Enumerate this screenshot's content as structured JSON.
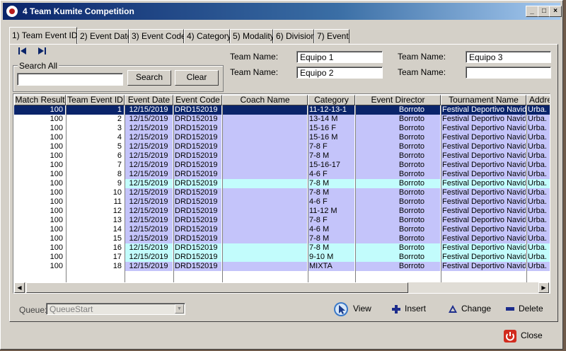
{
  "window": {
    "title": "4 Team Kumite Competition",
    "controls": [
      "_",
      "□",
      "×"
    ]
  },
  "tabs": [
    {
      "label": "1) Team Event ID",
      "active": true
    },
    {
      "label": "2) Event Date"
    },
    {
      "label": "3) Event Code"
    },
    {
      "label": "4) Category"
    },
    {
      "label": "5) Modality"
    },
    {
      "label": "6) Division"
    },
    {
      "label": "7) Event"
    }
  ],
  "nav": {
    "first_icon": "first-record-icon",
    "last_icon": "last-record-icon"
  },
  "search": {
    "group_label": "Search All",
    "value": "",
    "search_button": "Search",
    "clear_button": "Clear"
  },
  "team_names": {
    "label": "Team Name:",
    "team1": "Equipo 1",
    "team2": "Equipo 2",
    "team3": "Equipo 3",
    "team4": ""
  },
  "grid": {
    "columns": [
      "Match Result",
      "Team Event ID",
      "Event Date",
      "Event Code",
      "Coach Name",
      "Category",
      "Event Director",
      "Tournament Name",
      "Addre"
    ],
    "rows": [
      {
        "match_result": "100",
        "team_event_id": "1",
        "event_date": "12/15/2019",
        "event_code": "DRD152019",
        "coach_name": "",
        "category": "11-12-13-1",
        "event_director": "Borroto",
        "tournament_name": "Festival Deportivo Navid",
        "address": "Urba. I",
        "state": "selected"
      },
      {
        "match_result": "100",
        "team_event_id": "2",
        "event_date": "12/15/2019",
        "event_code": "DRD152019",
        "coach_name": "",
        "category": "13-14 M",
        "event_director": "Borroto",
        "tournament_name": "Festival Deportivo Navid",
        "address": "Urba. I",
        "state": "purple"
      },
      {
        "match_result": "100",
        "team_event_id": "3",
        "event_date": "12/15/2019",
        "event_code": "DRD152019",
        "coach_name": "",
        "category": "15-16 F",
        "event_director": "Borroto",
        "tournament_name": "Festival Deportivo Navid",
        "address": "Urba. I",
        "state": "purple"
      },
      {
        "match_result": "100",
        "team_event_id": "4",
        "event_date": "12/15/2019",
        "event_code": "DRD152019",
        "coach_name": "",
        "category": "15-16 M",
        "event_director": "Borroto",
        "tournament_name": "Festival Deportivo Navid",
        "address": "Urba. I",
        "state": "purple"
      },
      {
        "match_result": "100",
        "team_event_id": "5",
        "event_date": "12/15/2019",
        "event_code": "DRD152019",
        "coach_name": "",
        "category": "7-8 F",
        "event_director": "Borroto",
        "tournament_name": "Festival Deportivo Navid",
        "address": "Urba. I",
        "state": "purple"
      },
      {
        "match_result": "100",
        "team_event_id": "6",
        "event_date": "12/15/2019",
        "event_code": "DRD152019",
        "coach_name": "",
        "category": "7-8 M",
        "event_director": "Borroto",
        "tournament_name": "Festival Deportivo Navid",
        "address": "Urba. I",
        "state": "purple"
      },
      {
        "match_result": "100",
        "team_event_id": "7",
        "event_date": "12/15/2019",
        "event_code": "DRD152019",
        "coach_name": "",
        "category": "15-16-17",
        "event_director": "Borroto",
        "tournament_name": "Festival Deportivo Navid",
        "address": "Urba. I",
        "state": "purple"
      },
      {
        "match_result": "100",
        "team_event_id": "8",
        "event_date": "12/15/2019",
        "event_code": "DRD152019",
        "coach_name": "",
        "category": "4-6 F",
        "event_director": "Borroto",
        "tournament_name": "Festival Deportivo Navid",
        "address": "Urba. I",
        "state": "purple"
      },
      {
        "match_result": "100",
        "team_event_id": "9",
        "event_date": "12/15/2019",
        "event_code": "DRD152019",
        "coach_name": "",
        "category": "7-8 M",
        "event_director": "Borroto",
        "tournament_name": "Festival Deportivo Navid",
        "address": "Urba. I",
        "state": "cyan"
      },
      {
        "match_result": "100",
        "team_event_id": "10",
        "event_date": "12/15/2019",
        "event_code": "DRD152019",
        "coach_name": "",
        "category": "7-8 M",
        "event_director": "Borroto",
        "tournament_name": "Festival Deportivo Navid",
        "address": "Urba. I",
        "state": "purple"
      },
      {
        "match_result": "100",
        "team_event_id": "11",
        "event_date": "12/15/2019",
        "event_code": "DRD152019",
        "coach_name": "",
        "category": "4-6 F",
        "event_director": "Borroto",
        "tournament_name": "Festival Deportivo Navid",
        "address": "Urba. I",
        "state": "purple"
      },
      {
        "match_result": "100",
        "team_event_id": "12",
        "event_date": "12/15/2019",
        "event_code": "DRD152019",
        "coach_name": "",
        "category": "11-12 M",
        "event_director": "Borroto",
        "tournament_name": "Festival Deportivo Navid",
        "address": "Urba. I",
        "state": "purple"
      },
      {
        "match_result": "100",
        "team_event_id": "13",
        "event_date": "12/15/2019",
        "event_code": "DRD152019",
        "coach_name": "",
        "category": "7-8 F",
        "event_director": "Borroto",
        "tournament_name": "Festival Deportivo Navid",
        "address": "Urba. I",
        "state": "purple"
      },
      {
        "match_result": "100",
        "team_event_id": "14",
        "event_date": "12/15/2019",
        "event_code": "DRD152019",
        "coach_name": "",
        "category": "4-6 M",
        "event_director": "Borroto",
        "tournament_name": "Festival Deportivo Navid",
        "address": "Urba. I",
        "state": "purple"
      },
      {
        "match_result": "100",
        "team_event_id": "15",
        "event_date": "12/15/2019",
        "event_code": "DRD152019",
        "coach_name": "",
        "category": "7-8 M",
        "event_director": "Borroto",
        "tournament_name": "Festival Deportivo Navid",
        "address": "Urba. I",
        "state": "purple"
      },
      {
        "match_result": "100",
        "team_event_id": "16",
        "event_date": "12/15/2019",
        "event_code": "DRD152019",
        "coach_name": "",
        "category": "7-8 M",
        "event_director": "Borroto",
        "tournament_name": "Festival Deportivo Navid",
        "address": "Urba. I",
        "state": "cyan"
      },
      {
        "match_result": "100",
        "team_event_id": "17",
        "event_date": "12/15/2019",
        "event_code": "DRD152019",
        "coach_name": "",
        "category": "9-10 M",
        "event_director": "Borroto",
        "tournament_name": "Festival Deportivo Navid",
        "address": "Urba. I",
        "state": "cyan"
      },
      {
        "match_result": "100",
        "team_event_id": "18",
        "event_date": "12/15/2019",
        "event_code": "DRD152019",
        "coach_name": "",
        "category": "MIXTA",
        "event_director": "Borroto",
        "tournament_name": "Festival Deportivo Navid",
        "address": "Urba. I",
        "state": "purple"
      }
    ]
  },
  "queue": {
    "label": "Queue:",
    "value": "QueueStart"
  },
  "actions": {
    "view": "View",
    "insert": "Insert",
    "change": "Change",
    "delete": "Delete",
    "close": "Close"
  },
  "colors": {
    "selected": "#0a246a",
    "purple": "#c4c4fa",
    "cyan": "#c2fcfc",
    "title_start": "#0a246a",
    "title_end": "#a6caf0"
  }
}
